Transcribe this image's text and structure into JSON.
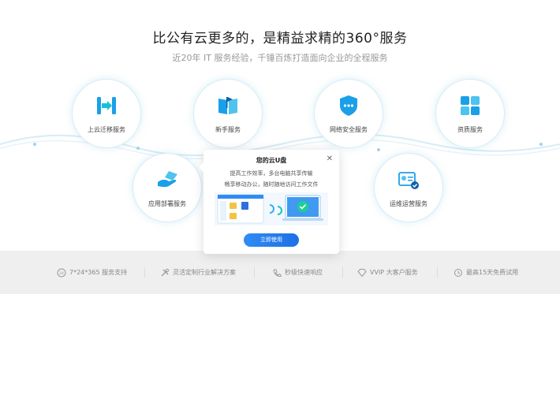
{
  "header": {
    "title": "比公有云更多的，是精益求精的360°服务",
    "subtitle": "近20年 IT 服务经验，千锤百炼打造面向企业的全程服务"
  },
  "services": [
    {
      "label": "上云迁移服务",
      "icon": "migration-icon"
    },
    {
      "label": "新手服务",
      "icon": "book-flag-icon"
    },
    {
      "label": "网络安全服务",
      "icon": "shield-icon"
    },
    {
      "label": "资质服务",
      "icon": "grid-icon"
    },
    {
      "label": "应用部署服务",
      "icon": "hand-icon"
    },
    {
      "label": "运维运营服务",
      "icon": "certificate-icon"
    }
  ],
  "popup": {
    "title": "您的云U盘",
    "line1": "提高工作效率，多台电脑共享传输",
    "line2": "畅享移动办公，随时随地访问工作文件",
    "button": "立即使用"
  },
  "features": [
    {
      "label": "7*24*365 服务支持",
      "icon": "clock-24-icon"
    },
    {
      "label": "灵活定制行业解决方案",
      "icon": "tools-icon"
    },
    {
      "label": "秒级快速响应",
      "icon": "phone-icon"
    },
    {
      "label": "VVIP 大客户服务",
      "icon": "diamond-icon"
    },
    {
      "label": "最高15天免费试用",
      "icon": "trial-icon"
    }
  ],
  "colors": {
    "accent": "#1e86e6",
    "icon_blue": "#1aa0e8",
    "strip_bg": "#efefef"
  }
}
